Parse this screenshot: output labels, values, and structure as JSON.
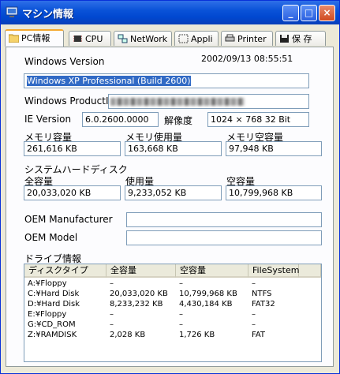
{
  "window": {
    "title": "マシン情報",
    "buttons": [
      "_",
      "□",
      "×"
    ]
  },
  "tabs": [
    {
      "label": "PC情報",
      "icon": "folder-icon"
    },
    {
      "label": "CPU",
      "icon": "chip-icon"
    },
    {
      "label": "NetWork",
      "icon": "network-icon"
    },
    {
      "label": "Appli",
      "icon": "appli-icon"
    },
    {
      "label": "Printer",
      "icon": "printer-icon"
    },
    {
      "label": "保 存",
      "icon": "floppy-save-icon"
    }
  ],
  "pc": {
    "windows_version_label": "Windows Version",
    "datetime": "2002/09/13 08:55:51",
    "windows_version": "Windows XP Professional (Build 2600)",
    "product_id_label": "Windows ProductID",
    "ie_version_label": "IE Version",
    "ie_version": "6.0.2600.0000",
    "resolution_label": "解像度",
    "resolution": "1024 × 768 32 Bit",
    "memory_total_label": "メモリ容量",
    "memory_total": "261,616 KB",
    "memory_used_label": "メモリ使用量",
    "memory_used": "163,668 KB",
    "memory_free_label": "メモリ空容量",
    "memory_free": "97,948 KB",
    "system_disk_label": "システムハードディスク",
    "disk_total_label": "全容量",
    "disk_total": "20,033,020 KB",
    "disk_used_label": "使用量",
    "disk_used": "9,233,052 KB",
    "disk_free_label": "空容量",
    "disk_free": "10,799,968 KB",
    "oem_manufacturer_label": "OEM Manufacturer",
    "oem_manufacturer": "",
    "oem_model_label": "OEM Model",
    "oem_model": ""
  },
  "drives": {
    "label": "ドライブ情報",
    "columns": [
      "ディスクタイプ",
      "全容量",
      "空容量",
      "FileSystem"
    ],
    "rows": [
      [
        "A:¥Floppy",
        "–",
        "–",
        "–"
      ],
      [
        "C:¥Hard Disk",
        "20,033,020 KB",
        "10,799,968 KB",
        "NTFS"
      ],
      [
        "D:¥Hard Disk",
        "8,233,232 KB",
        "4,430,184 KB",
        "FAT32"
      ],
      [
        "E:¥Floppy",
        "–",
        "–",
        "–"
      ],
      [
        "G:¥CD_ROM",
        "–",
        "–",
        "–"
      ],
      [
        "Z:¥RAMDISK",
        "2,028 KB",
        "1,726 KB",
        "FAT"
      ]
    ]
  }
}
